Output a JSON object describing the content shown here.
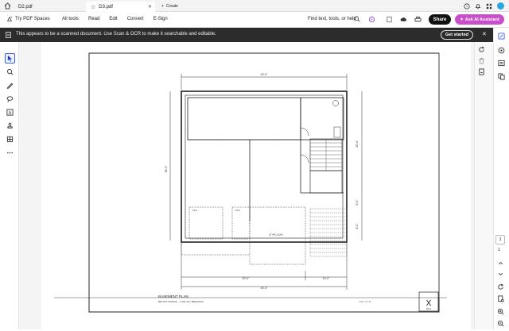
{
  "tabs": [
    {
      "label": "D2.pdf",
      "active": false
    },
    {
      "label": "D3.pdf",
      "active": true
    }
  ],
  "create_label": "Create",
  "menubar": {
    "spaces_label": "Try PDF Spaces",
    "items": [
      "All tools",
      "Read",
      "Edit",
      "Convert",
      "E-Sign"
    ],
    "find_placeholder": "Find text, tools, or help",
    "share_label": "Share",
    "ai_label": "Ask AI Assistant"
  },
  "infobar": {
    "message": "This appears to be a scanned document. Use Scan & OCR to make it searchable and editable.",
    "button_label": "Get started"
  },
  "plan": {
    "top_dim": "43'-0\"",
    "left_dim": "38'-0\"",
    "right_dim_a": "20'-0\"",
    "right_dim_b": "8'-0\"",
    "right_dim_c": "8'-0\"",
    "bottom_dim_a": "30'-0\"",
    "bottom_dim_b": "13'-0\"",
    "bottom_dim_total": "43'-0\"",
    "room_label": "(TYP) 10'H",
    "col_a": "FTG",
    "col_b": "FTG",
    "title": "BASEMENT PLAN",
    "subtitle": "808 SFT (FINISH)  ·  1,096 SFT (BEARING)",
    "scale": "1/4\" = 1'-0\"",
    "sheet_mark": "X",
    "sheet_of": "OF 4"
  },
  "page": {
    "current": "1",
    "total": "1"
  },
  "colors": {
    "accent": "#3760e8",
    "ai": "#c84fc9",
    "infobar": "#2c2c2c"
  }
}
